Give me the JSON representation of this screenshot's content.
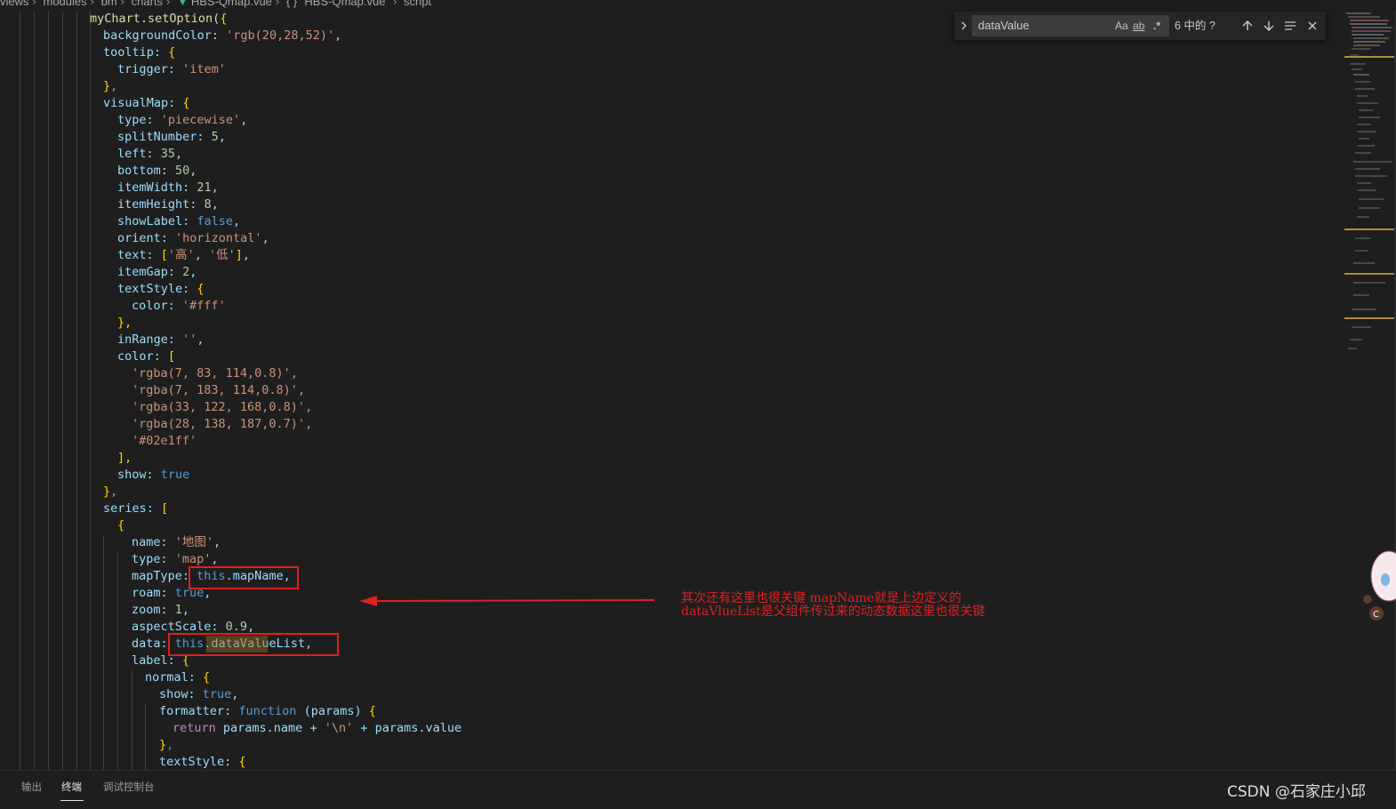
{
  "breadcrumb": {
    "items": [
      "views",
      "modules",
      "bm",
      "charts",
      "HBS-Qmap.vue",
      "{ } \"HBS-Qmap.vue\"",
      "script"
    ],
    "separator": "›"
  },
  "find_widget": {
    "query": "dataValue",
    "match_case_label": "Aa",
    "whole_word_label": "ab",
    "regex_label": ".*",
    "result_count": "6 中的 ?",
    "prev_icon": "arrow-up-icon",
    "next_icon": "arrow-down-icon",
    "selection_icon": "find-in-selection-icon",
    "close_icon": "close-icon"
  },
  "code": {
    "l01": "myChart.setOption({",
    "l02": "backgroundColor: 'rgb(20,28,52)',",
    "l03": "tooltip: {",
    "l04": "trigger: 'item'",
    "l05": "},",
    "l06": "visualMap: {",
    "l07": "type: 'piecewise',",
    "l08": "splitNumber: 5,",
    "l09": "left: 35,",
    "l10": "bottom: 50,",
    "l11": "itemWidth: 21,",
    "l12": "itemHeight: 8,",
    "l13": "showLabel: false,",
    "l14": "orient: 'horizontal',",
    "l15": "text: ['高', '低'],",
    "l16": "itemGap: 2,",
    "l17": "textStyle: {",
    "l18": "color: '#fff'",
    "l19": "},",
    "l20": "inRange: '',",
    "l21": "color: [",
    "l22": "'rgba(7, 83, 114,0.8)',",
    "l23": "'rgba(7, 183, 114,0.8)',",
    "l24": "'rgba(33, 122, 168,0.8)',",
    "l25": "'rgba(28, 138, 187,0.7)',",
    "l26": "'#02e1ff'",
    "l27": "],",
    "l28": "show: true",
    "l29": "},",
    "l30": "series: [",
    "l31": "{",
    "l32": "name: '地图',",
    "l33": "type: 'map',",
    "l34": "mapType: this.mapName,",
    "l35": "roam: true,",
    "l36": "zoom: 1,",
    "l37": "aspectScale: 0.9,",
    "l38": "data: this.dataValueList,",
    "l39": "label: {",
    "l40": "normal: {",
    "l41": "show: true,",
    "l42": "formatter: function (params) {",
    "l43": "return params.name + '\\n' + params.value",
    "l44": "},",
    "l45": "textStyle: {"
  },
  "annotation": {
    "line1": "其次还有这里也很关键 mapName就是上边定义的",
    "line2": "dataVlueList是父组件传过来的动态数据这里也很关键",
    "color": "#e02020"
  },
  "panel": {
    "tabs": [
      "输出",
      "终端",
      "调试控制台"
    ],
    "active_tab": "终端"
  },
  "watermark": "CSDN @石家庄小邱",
  "theme": {
    "background": "#1e1e1e",
    "property": "#9cdcfe",
    "string": "#ce9178",
    "number": "#b5cea8",
    "keyword": "#569cd6"
  }
}
